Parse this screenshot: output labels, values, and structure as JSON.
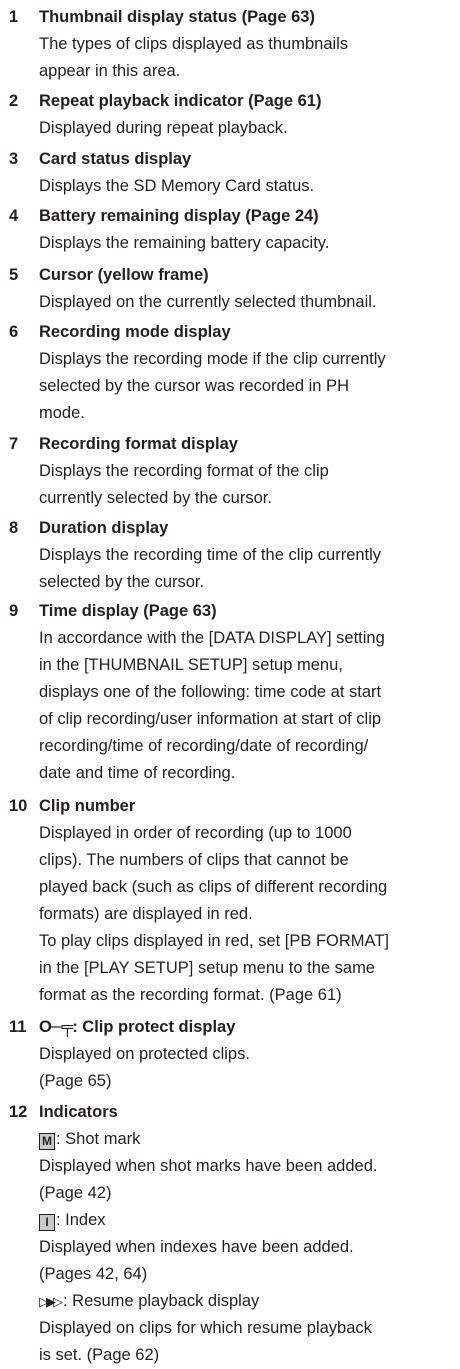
{
  "items": [
    {
      "num": "1",
      "title": "Thumbnail display status (Page 63)",
      "lines": [
        "The types of clips displayed as thumbnails",
        "appear in this area."
      ]
    },
    {
      "num": "2",
      "title": "Repeat playback indicator (Page 61)",
      "lines": [
        "Displayed during repeat playback."
      ]
    },
    {
      "num": "3",
      "title": "Card status display",
      "lines": [
        "Displays the SD Memory Card status."
      ]
    },
    {
      "num": "4",
      "title": "Battery remaining display (Page 24)",
      "lines": [
        "Displays the remaining battery capacity."
      ]
    },
    {
      "num": "5",
      "title": "Cursor (yellow frame)",
      "lines": [
        "Displayed on the currently selected thumbnail."
      ]
    },
    {
      "num": "6",
      "title": "Recording mode display",
      "lines": [
        "Displays the recording mode if the clip currently",
        "selected by the cursor was recorded in PH",
        "mode."
      ]
    },
    {
      "num": "7",
      "title": "Recording format display",
      "lines": [
        "Displays the recording format of the clip",
        "currently selected by the cursor."
      ]
    },
    {
      "num": "8",
      "title": "Duration display",
      "lines": [
        "Displays the recording time of the clip currently",
        "selected by the cursor."
      ]
    },
    {
      "num": "9",
      "title": "Time display (Page 63)",
      "lines": [
        "In accordance with the [DATA DISPLAY] setting",
        "in the [THUMBNAIL SETUP] setup menu,",
        "displays one of the following: time code at start",
        "of clip recording/user information at start of clip",
        "recording/time of recording/date of recording/",
        "date and time of recording."
      ]
    },
    {
      "num": "10",
      "title": "Clip number",
      "lines": [
        "Displayed in order of recording (up to 1000",
        "clips). The numbers of clips that cannot be",
        "played back (such as clips of different recording",
        "formats) are displayed in red.",
        "To play clips displayed in red, set [PB FORMAT]",
        "in the [PLAY SETUP] setup menu to the same",
        "format as the recording format. (Page 61)"
      ]
    },
    {
      "num": "11",
      "title_symbol": "O─╤",
      "title": ": Clip protect display",
      "lines": [
        "Displayed on protected clips.",
        "(Page 65)"
      ]
    },
    {
      "num": "12",
      "title": "Indicators",
      "indicators": {
        "shot_mark": {
          "badge": "M",
          "label": ": Shot mark",
          "lines": [
            "Displayed when shot marks have been added.",
            "(Page 42)"
          ]
        },
        "index": {
          "badge": "I",
          "label": ": Index",
          "lines": [
            "Displayed when indexes have been added.",
            "(Pages 42, 64)"
          ]
        },
        "resume": {
          "symbol": "▷▶▷",
          "label": ": Resume playback display",
          "lines": [
            "Displayed on clips for which resume playback",
            "is set. (Page 62)"
          ]
        }
      }
    }
  ]
}
